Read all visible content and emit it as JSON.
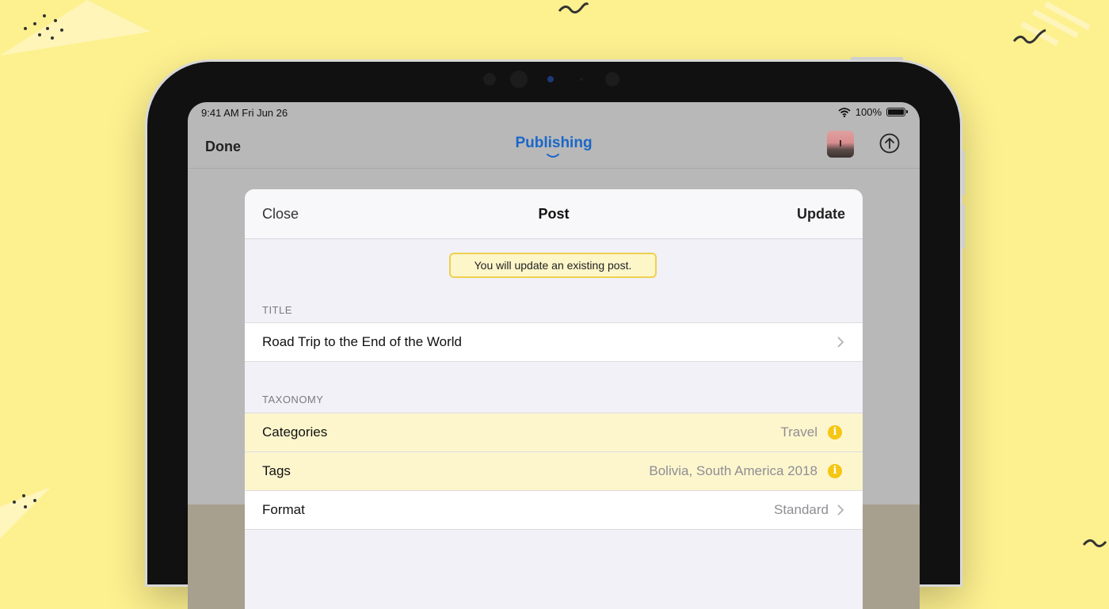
{
  "status_bar": {
    "time": "9:41 AM   Fri Jun 26",
    "battery": "100%"
  },
  "nav": {
    "done_label": "Done",
    "title": "Publishing"
  },
  "sheet": {
    "close_label": "Close",
    "title": "Post",
    "update_label": "Update",
    "notice": "You will update an existing post.",
    "title_section": "TITLE",
    "post_title": "Road Trip to the End of the World",
    "taxonomy_section": "TAXONOMY",
    "rows": [
      {
        "label": "Categories",
        "value": "Travel"
      },
      {
        "label": "Tags",
        "value": "Bolivia, South America 2018"
      },
      {
        "label": "Format",
        "value": "Standard"
      }
    ]
  },
  "colors": {
    "background": "#fdf08f",
    "accent": "#1a67c9",
    "warning": "#f5c613",
    "warning_row": "#fdf6cd"
  },
  "icons": [
    "wifi-icon",
    "battery-icon",
    "chevron-down-icon",
    "upload-icon",
    "chevron-right-icon",
    "info-icon"
  ]
}
